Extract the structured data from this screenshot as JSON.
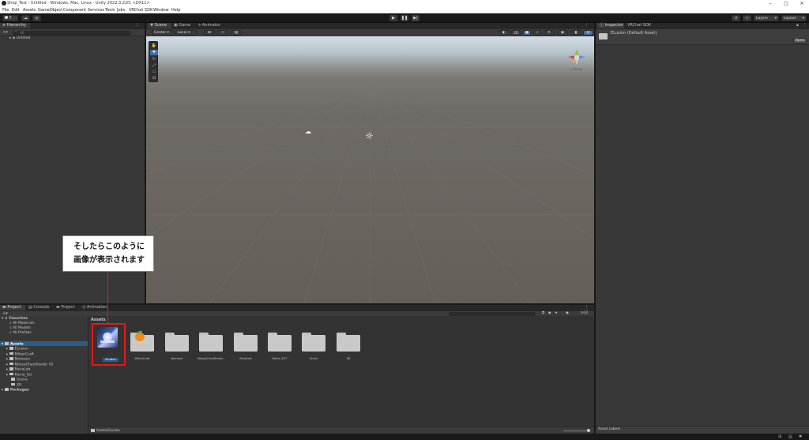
{
  "window": {
    "title": "Shop_Test - Untitled - Windows, Mac, Linux - Unity 2022.3.22f1 <DX11>",
    "controls": [
      "–",
      "□",
      "✕"
    ]
  },
  "menu": [
    "File",
    "Edit",
    "Assets",
    "GameObject",
    "Component",
    "Services",
    "Tools",
    "Jobs",
    "VRChat SDK",
    "Window",
    "Help"
  ],
  "toolbar": {
    "account": "S",
    "layers_label": "Layers",
    "layout_label": "Layout"
  },
  "hierarchy": {
    "tab": "Hierarchy",
    "search_placeholder": "All",
    "scene_name": "Untitled"
  },
  "scene": {
    "tabs": [
      "Scene",
      "Game",
      "Animator"
    ],
    "pivot": "Center",
    "space": "Local",
    "mode_2d": "2D",
    "persp_label": "< Persp"
  },
  "inspector": {
    "tabs": [
      "Inspector",
      "VRChat SDK"
    ],
    "asset_title": "ELusion (Default Asset)",
    "open_button": "Open",
    "asset_labels": "Asset Labels"
  },
  "project": {
    "tabs": [
      "Project",
      "Console",
      "Project",
      "Animation"
    ],
    "favorites_header": "Favorites",
    "favorites": [
      "All Materials",
      "All Models",
      "All Prefabs"
    ],
    "assets_header": "Assets",
    "asset_folders": [
      "ELusion",
      "MikanCraft",
      "Nemesis",
      "NiloyaChanShader V2",
      "ReiraLab",
      "Reiria_ScI",
      "Scene",
      "XR"
    ],
    "packages_header": "Packages",
    "breadcrumb": "Assets",
    "grid_items": [
      "ELusion",
      "MikanCraft",
      "Nemesis",
      "NiloyaChanShader...",
      "ReiraLab",
      "Reiria_SOT",
      "Scene",
      "XR"
    ],
    "path": "Assets/ELusion",
    "hidden_count": "32"
  },
  "annotation": {
    "line1": "そしたらこのように",
    "line2": "画像が表示されます",
    "color": "#e01b1b"
  }
}
